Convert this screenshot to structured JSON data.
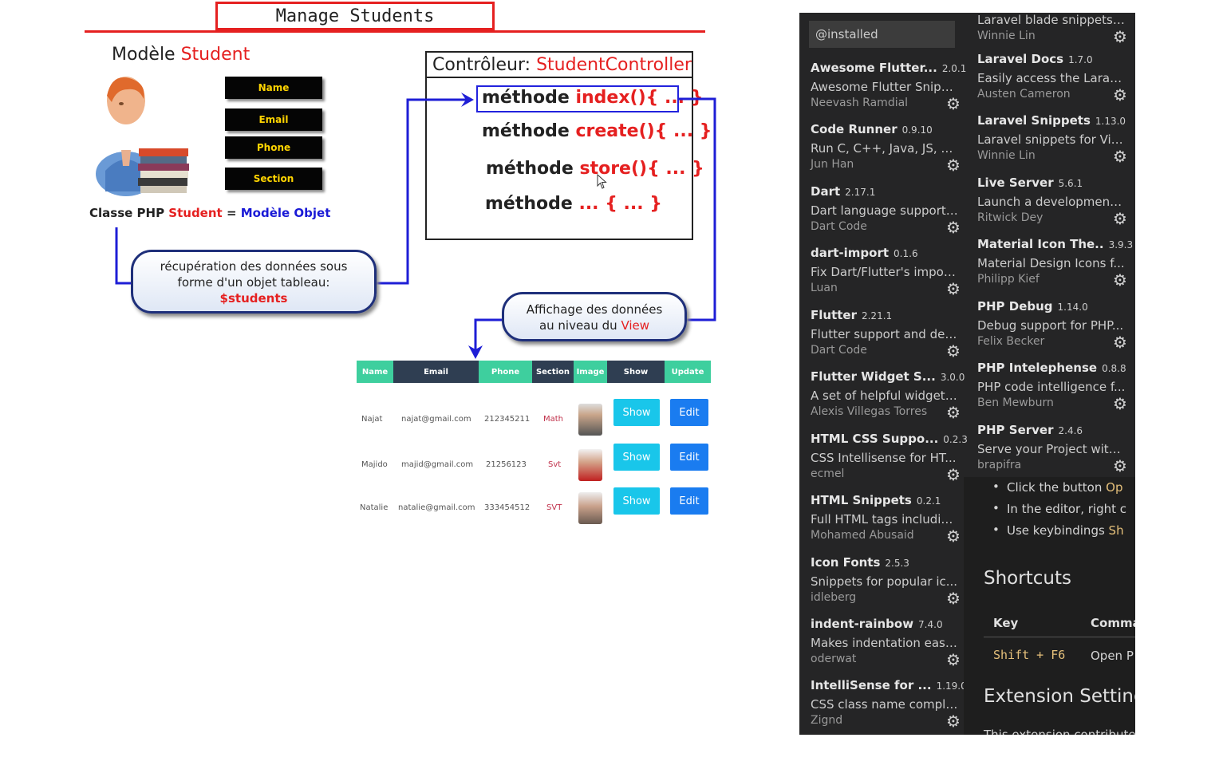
{
  "diagram": {
    "title": "Manage Students",
    "model_prefix": "Modèle ",
    "model_name": "Student",
    "fields": [
      "Name",
      "Email",
      "Phone",
      "Section"
    ],
    "caption_prefix": "Classe PHP ",
    "caption_student": "Student",
    "caption_eq": " = ",
    "caption_obj": "Modèle Objet",
    "controller_prefix": "Contrôleur: ",
    "controller_name": "StudentController",
    "methods": [
      {
        "prefix": "méthode ",
        "name": "index(){ ... }"
      },
      {
        "prefix": "méthode ",
        "name": "create(){ ... }"
      },
      {
        "prefix": "méthode ",
        "name": "store(){ ... }"
      },
      {
        "prefix": "méthode ",
        "name": "... { ... }"
      }
    ],
    "bubble_left_line1": "récupération des données sous",
    "bubble_left_line2": "forme d'un objet tableau:",
    "bubble_left_var": "$students",
    "bubble_right_line1": "Affichage des données",
    "bubble_right_line2_prefix": "au niveau du ",
    "bubble_right_view": "View",
    "table": {
      "headers": [
        "Name",
        "Email",
        "Phone",
        "Section",
        "Image",
        "Show",
        "Update"
      ],
      "header_colors": [
        "#3ecf9e",
        "#2f3e52",
        "#3ecf9e",
        "#2f3e52",
        "#3ecf9e",
        "#2f3e52",
        "#3ecf9e"
      ],
      "rows": [
        {
          "name": "Najat",
          "email": "najat@gmail.com",
          "phone": "212345211",
          "section": "Math",
          "show": "Show",
          "edit": "Edit"
        },
        {
          "name": "Majido",
          "email": "majid@gmail.com",
          "phone": "21256123",
          "section": "Svt",
          "show": "Show",
          "edit": "Edit"
        },
        {
          "name": "Natalie",
          "email": "natalie@gmail.com",
          "phone": "333454512",
          "section": "SVT",
          "show": "Show",
          "edit": "Edit"
        }
      ]
    }
  },
  "vscode": {
    "search_value": "@installed",
    "left_column": [
      {
        "name": "Awesome Flutter...",
        "version": "2.0.1",
        "description": "Awesome Flutter Snipp...",
        "author": "Neevash Ramdial"
      },
      {
        "name": "Code Runner",
        "version": "0.9.10",
        "description": "Run C, C++, Java, JS, PH...",
        "author": "Jun Han"
      },
      {
        "name": "Dart",
        "version": "2.17.1",
        "description": "Dart language support ...",
        "author": "Dart Code"
      },
      {
        "name": "dart-import",
        "version": "0.1.6",
        "description": "Fix Dart/Flutter's imports",
        "author": "Luan"
      },
      {
        "name": "Flutter",
        "version": "2.21.1",
        "description": "Flutter support and deb...",
        "author": "Dart Code"
      },
      {
        "name": "Flutter Widget S...",
        "version": "3.0.0",
        "description": "A set of helpful widget ...",
        "author": "Alexis Villegas Torres"
      },
      {
        "name": "HTML CSS Suppo...",
        "version": "0.2.3",
        "description": "CSS Intellisense for HT...",
        "author": "ecmel"
      },
      {
        "name": "HTML Snippets",
        "version": "0.2.1",
        "description": "Full HTML tags includin...",
        "author": "Mohamed Abusaid"
      },
      {
        "name": "Icon Fonts",
        "version": "2.5.3",
        "description": "Snippets for popular ic...",
        "author": "idleberg"
      },
      {
        "name": "indent-rainbow",
        "version": "7.4.0",
        "description": "Makes indentation easi...",
        "author": "oderwat"
      },
      {
        "name": "IntelliSense for ...",
        "version": "1.19.0",
        "description": "CSS class name comple...",
        "author": "Zignd"
      }
    ],
    "right_column_partial": {
      "description": "Laravel blade snippets ...",
      "author": "Winnie Lin"
    },
    "right_column": [
      {
        "name": "Laravel Docs",
        "version": "1.7.0",
        "description": "Easily access the Larave...",
        "author": "Austen Cameron"
      },
      {
        "name": "Laravel Snippets",
        "version": "1.13.0",
        "description": "Laravel snippets for Vis...",
        "author": "Winnie Lin"
      },
      {
        "name": "Live Server",
        "version": "5.6.1",
        "description": "Launch a development ...",
        "author": "Ritwick Dey"
      },
      {
        "name": "Material Icon The..",
        "version": "3.9.3",
        "description": "Material Design Icons f...",
        "author": "Philipp Kief"
      },
      {
        "name": "PHP Debug",
        "version": "1.14.0",
        "description": "Debug support for PHP...",
        "author": "Felix Becker"
      },
      {
        "name": "PHP Intelephense",
        "version": "0.8.8",
        "description": "PHP code intelligence f...",
        "author": "Ben Mewburn"
      },
      {
        "name": "PHP Server",
        "version": "2.4.6",
        "description": "Serve your Project with...",
        "author": "brapifra"
      }
    ],
    "detail": {
      "bullets": [
        {
          "text": "Click the button ",
          "accent": "Op"
        },
        {
          "text": "In the editor, right c",
          "accent": ""
        },
        {
          "text": "Use keybindings ",
          "accent": "Sh"
        }
      ],
      "shortcuts_heading": "Shortcuts",
      "col_key": "Key",
      "col_command": "Comma",
      "shortcut_key": "Shift + F6",
      "shortcut_command": "Open P",
      "settings_heading": "Extension Settings",
      "contributes_text": "This extension contributes"
    }
  }
}
